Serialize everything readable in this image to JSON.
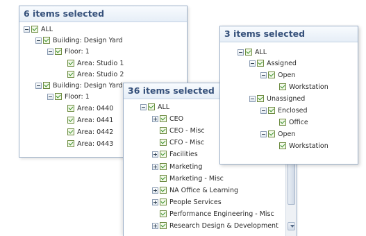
{
  "panel1": {
    "header": "6 items selected",
    "nodes": [
      "ALL",
      "Building: Design Yard",
      "Floor: 1",
      "Area: Studio 1",
      "Area: Studio 2",
      "Building: Design Yard",
      "Floor: 1",
      "Area: 0440",
      "Area: 0441",
      "Area: 0442",
      "Area: 0443"
    ]
  },
  "panel2": {
    "header": "36 items selected",
    "nodes": [
      "ALL",
      "CEO",
      "CEO - Misc",
      "CFO - Misc",
      "Facilities",
      "Marketing",
      "Marketing - Misc",
      "NA Office & Learning",
      "People Services",
      "Performance Engineering - Misc",
      "Research Design & Development"
    ]
  },
  "panel3": {
    "header": "3 items selected",
    "nodes": [
      "ALL",
      "Assigned",
      "Open",
      "Workstation",
      "Unassigned",
      "Enclosed",
      "Office",
      "Open",
      "Workstation"
    ]
  },
  "icons": {
    "expanded": "minus-box-icon",
    "collapsed": "plus-box-icon",
    "checked": "checkbox-checked-icon"
  },
  "colors": {
    "header_text": "#35507a",
    "border": "#9aaec7",
    "check": "#2f8a1f"
  }
}
